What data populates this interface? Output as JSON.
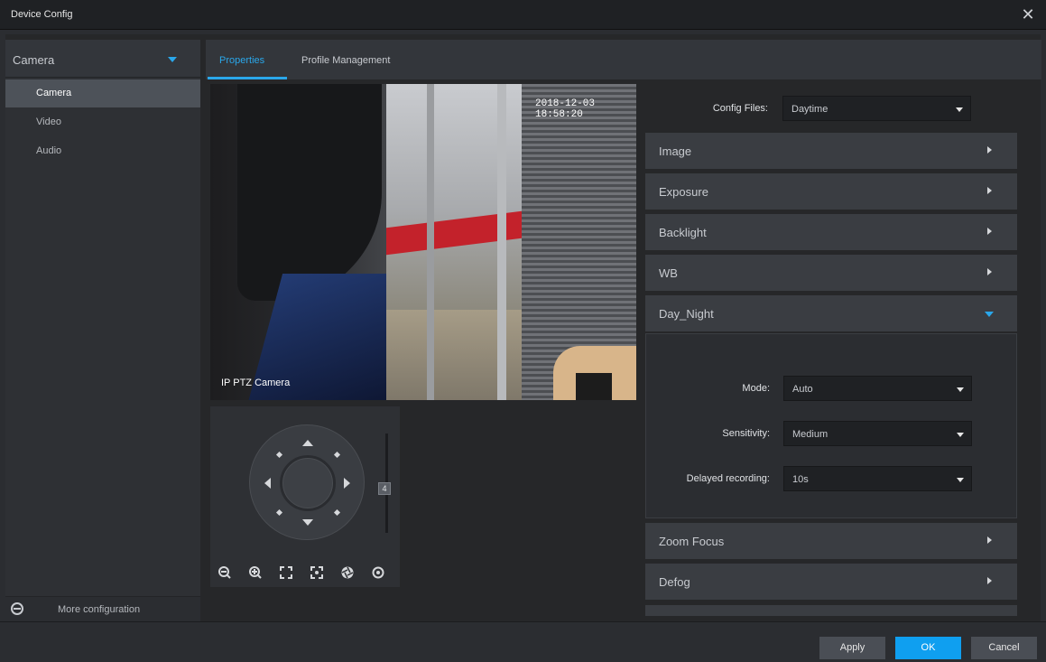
{
  "window": {
    "title": "Device Config",
    "close_glyph": "✕"
  },
  "sidebar": {
    "header": "Camera",
    "items": [
      {
        "label": "Camera",
        "active": true
      },
      {
        "label": "Video",
        "active": false
      },
      {
        "label": "Audio",
        "active": false
      }
    ],
    "footer_label": "More configuration"
  },
  "tabs": [
    {
      "label": "Properties",
      "active": true
    },
    {
      "label": "Profile Management",
      "active": false
    }
  ],
  "video": {
    "timestamp": "2018-12-03 18:58:20",
    "camera_label": "IP PTZ Camera"
  },
  "ptz": {
    "speed_value": "4",
    "tools": [
      "zoom-out-icon",
      "zoom-in-icon",
      "focus-far-icon",
      "focus-near-icon",
      "iris-icon",
      "refresh-icon"
    ]
  },
  "config": {
    "config_files_label": "Config Files:",
    "config_files_value": "Daytime",
    "sections": [
      {
        "label": "Image",
        "expanded": false
      },
      {
        "label": "Exposure",
        "expanded": false
      },
      {
        "label": "Backlight",
        "expanded": false
      },
      {
        "label": "WB",
        "expanded": false
      },
      {
        "label": "Day_Night",
        "expanded": true
      },
      {
        "label": "Zoom Focus",
        "expanded": false
      },
      {
        "label": "Defog",
        "expanded": false
      }
    ],
    "day_night": {
      "mode_label": "Mode:",
      "mode_value": "Auto",
      "sensitivity_label": "Sensitivity:",
      "sensitivity_value": "Medium",
      "delay_label": "Delayed recording:",
      "delay_value": "10s"
    }
  },
  "footer": {
    "apply": "Apply",
    "ok": "OK",
    "cancel": "Cancel"
  },
  "colors": {
    "accent": "#2aa7ea",
    "primary_button": "#0f9ff0",
    "background": "#2b2d31"
  }
}
